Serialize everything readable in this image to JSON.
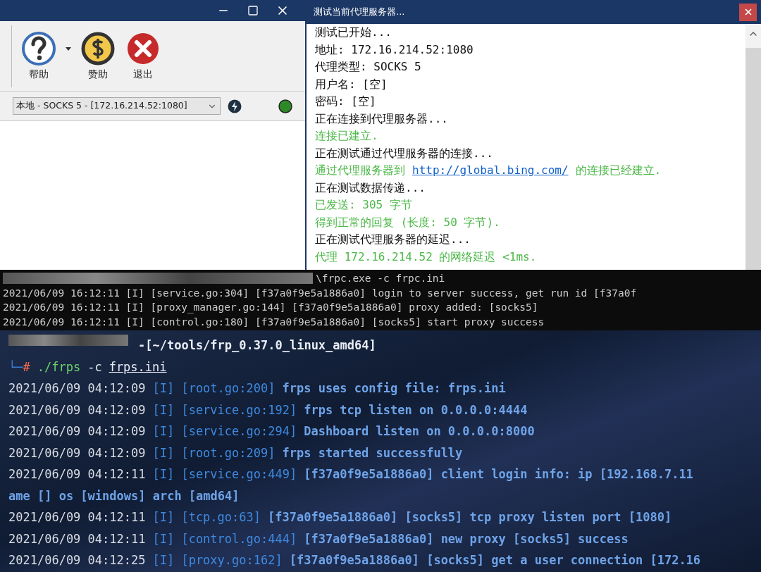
{
  "main_window": {
    "toolbar": [
      {
        "kind": "help",
        "label": "帮助",
        "has_menu": true
      },
      {
        "kind": "sponsor",
        "label": "赞助",
        "has_menu": false
      },
      {
        "kind": "exit",
        "label": "退出",
        "has_menu": false
      }
    ],
    "proxy_select": {
      "value": "本地 - SOCKS 5 - [172.16.214.52:1080]"
    },
    "connected": true
  },
  "dialog": {
    "title": "测试当前代理服务器...",
    "lines": [
      {
        "kind": "info",
        "text": "测试已开始..."
      },
      {
        "kind": "info",
        "text": "地址: 172.16.214.52:1080"
      },
      {
        "kind": "info",
        "text": "代理类型: SOCKS 5"
      },
      {
        "kind": "info",
        "text": "用户名: [空]"
      },
      {
        "kind": "info",
        "text": "密码: [空]"
      },
      {
        "kind": "info",
        "text": "正在连接到代理服务器..."
      },
      {
        "kind": "success",
        "text": "连接已建立."
      },
      {
        "kind": "info",
        "text": "正在测试通过代理服务器的连接..."
      },
      {
        "kind": "success",
        "text": "通过代理服务器到",
        "link": "http://global.bing.com/",
        "after": "的连接已经建立."
      },
      {
        "kind": "info",
        "text": "正在测试数据传递..."
      },
      {
        "kind": "success",
        "text": "已发送: 305 字节"
      },
      {
        "kind": "success",
        "text": "得到正常的回复 (长度: 50 字节)."
      },
      {
        "kind": "info",
        "text": "正在测试代理服务器的延迟..."
      },
      {
        "kind": "success",
        "text": "代理 172.16.214.52 的网络延迟 <1ms."
      }
    ]
  },
  "client_console": {
    "command": "\\frpc.exe -c frpc.ini",
    "lines": [
      "2021/06/09 16:12:11 [I] [service.go:304] [f37a0f9e5a1886a0] login to server success, get run id [f37a0f",
      "2021/06/09 16:12:11 [I] [proxy_manager.go:144] [f37a0f9e5a1886a0] proxy added: [socks5]",
      "2021/06/09 16:12:11 [I] [control.go:180] [f37a0f9e5a1886a0] [socks5] start proxy success"
    ]
  },
  "server_terminal": {
    "path": "-[~/tools/frp_0.37.0_linux_amd64]",
    "symbol": "└─#",
    "command": [
      {
        "kind": "program",
        "text": "./frps"
      },
      {
        "kind": "flag",
        "text": "-c"
      },
      {
        "kind": "file",
        "text": "frps.ini"
      }
    ],
    "lines": [
      {
        "kind": "log",
        "time": "2021/06/09 04:12:09",
        "tag": "[I] [root.go:200]",
        "text": "frps uses config file: frps.ini"
      },
      {
        "kind": "log",
        "time": "2021/06/09 04:12:09",
        "tag": "[I] [service.go:192]",
        "text": "frps tcp listen on 0.0.0.0:4444"
      },
      {
        "kind": "log",
        "time": "2021/06/09 04:12:09",
        "tag": "[I] [service.go:294]",
        "text": "Dashboard listen on 0.0.0.0:8000"
      },
      {
        "kind": "log",
        "time": "2021/06/09 04:12:09",
        "tag": "[I] [root.go:209]",
        "text": "frps started successfully"
      },
      {
        "kind": "log",
        "time": "2021/06/09 04:12:11",
        "tag": "[I] [service.go:449]",
        "text": "[f37a0f9e5a1886a0] client login info: ip [192.168.7.11"
      },
      {
        "kind": "continuation",
        "text": "ame [] os [windows] arch [amd64]"
      },
      {
        "kind": "log",
        "time": "2021/06/09 04:12:11",
        "tag": "[I] [tcp.go:63]",
        "text": "[f37a0f9e5a1886a0] [socks5] tcp proxy listen port [1080]"
      },
      {
        "kind": "log",
        "time": "2021/06/09 04:12:11",
        "tag": "[I] [control.go:444]",
        "text": "[f37a0f9e5a1886a0] new proxy [socks5] success"
      },
      {
        "kind": "log",
        "time": "2021/06/09 04:12:25",
        "tag": "[I] [proxy.go:162]",
        "text": "[f37a0f9e5a1886a0] [socks5] get a user connection [172.16"
      }
    ]
  }
}
